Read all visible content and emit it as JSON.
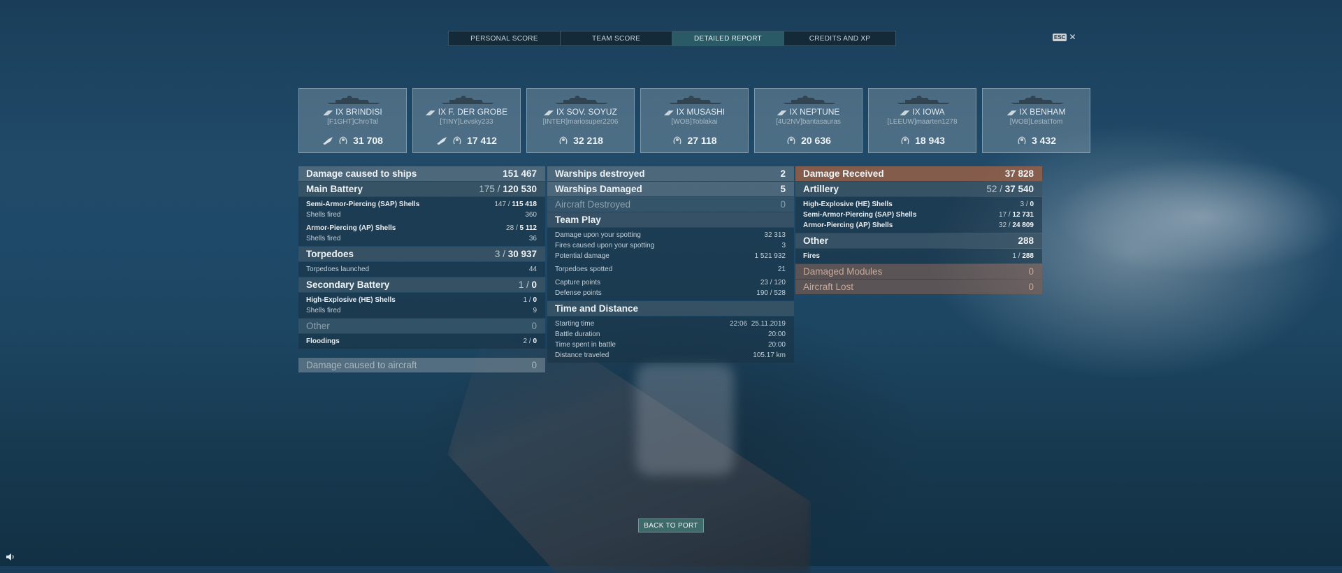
{
  "tabs": [
    {
      "label": "PERSONAL SCORE"
    },
    {
      "label": "TEAM SCORE"
    },
    {
      "label": "DETAILED REPORT"
    },
    {
      "label": "CREDITS AND XP"
    }
  ],
  "esc": {
    "key": "ESC",
    "close": "✕"
  },
  "ships": [
    {
      "tier": "IX",
      "name": "BRINDISI",
      "player": "[F1GHT]ChroTal",
      "score": "31 708",
      "has_plane": true
    },
    {
      "tier": "IX",
      "name": "F. DER GROBE",
      "player": "[TINY]Levsky233",
      "score": "17 412",
      "has_plane": true
    },
    {
      "tier": "IX",
      "name": "SOV. SOYUZ",
      "player": "[INTER]mariosuper2206",
      "score": "32 218",
      "has_plane": false
    },
    {
      "tier": "IX",
      "name": "MUSASHI",
      "player": "[WOB]Toblakai",
      "score": "27 118",
      "has_plane": false
    },
    {
      "tier": "IX",
      "name": "NEPTUNE",
      "player": "[4U2NV]bantasauras",
      "score": "20 636",
      "has_plane": false
    },
    {
      "tier": "IX",
      "name": "IOWA",
      "player": "[LEEUW]maarten1278",
      "score": "18 943",
      "has_plane": false
    },
    {
      "tier": "IX",
      "name": "BENHAM",
      "player": "[WOB]LestatTom",
      "score": "3 432",
      "has_plane": false
    }
  ],
  "damage": {
    "title": "Damage caused to ships",
    "total": "151 467",
    "main_battery": {
      "label": "Main Battery",
      "hits": "175",
      "dmg": "120 530"
    },
    "sap": {
      "label": "Semi-Armor-Piercing (SAP) Shells",
      "hits": "147",
      "dmg": "115 418"
    },
    "sap_fired": {
      "label": "Shells fired",
      "value": "360"
    },
    "ap": {
      "label": "Armor-Piercing (AP) Shells",
      "hits": "28",
      "dmg": "5 112"
    },
    "ap_fired": {
      "label": "Shells fired",
      "value": "36"
    },
    "torpedoes": {
      "label": "Torpedoes",
      "hits": "3",
      "dmg": "30 937"
    },
    "torp_launched": {
      "label": "Torpedoes launched",
      "value": "44"
    },
    "secondary": {
      "label": "Secondary Battery",
      "hits": "1",
      "dmg": "0"
    },
    "he": {
      "label": "High-Explosive (HE) Shells",
      "hits": "1",
      "dmg": "0"
    },
    "he_fired": {
      "label": "Shells fired",
      "value": "9"
    },
    "other": {
      "label": "Other",
      "value": "0"
    },
    "floodings": {
      "label": "Floodings",
      "hits": "2",
      "dmg": "0"
    },
    "aircraft": {
      "label": "Damage caused to aircraft",
      "value": "0"
    }
  },
  "warships": {
    "destroyed": {
      "label": "Warships destroyed",
      "value": "2"
    },
    "damaged": {
      "label": "Warships Damaged",
      "value": "5"
    },
    "aircraft": {
      "label": "Aircraft Destroyed",
      "value": "0"
    }
  },
  "team_play": {
    "title": "Team Play",
    "spotting_damage": {
      "label": "Damage upon your spotting",
      "value": "32 313"
    },
    "spotting_fires": {
      "label": "Fires caused upon your spotting",
      "value": "3"
    },
    "potential": {
      "label": "Potential damage",
      "value": "1 521 932"
    },
    "torps_spotted": {
      "label": "Torpedoes spotted",
      "value": "21"
    },
    "capture": {
      "label": "Capture points",
      "a": "23",
      "b": "120"
    },
    "defense": {
      "label": "Defense points",
      "a": "190",
      "b": "528"
    }
  },
  "time": {
    "title": "Time and Distance",
    "start": {
      "label": "Starting time",
      "time": "22:06",
      "date": "25.11.2019"
    },
    "duration": {
      "label": "Battle duration",
      "value": "20:00"
    },
    "spent": {
      "label": "Time spent in battle",
      "value": "20:00"
    },
    "distance": {
      "label": "Distance traveled",
      "value": "105.17 km"
    }
  },
  "received": {
    "title": "Damage Received",
    "total": "37 828",
    "artillery": {
      "label": "Artillery",
      "hits": "52",
      "dmg": "37 540"
    },
    "he": {
      "label": "High-Explosive (HE) Shells",
      "hits": "3",
      "dmg": "0"
    },
    "sap": {
      "label": "Semi-Armor-Piercing (SAP) Shells",
      "hits": "17",
      "dmg": "12 731"
    },
    "ap": {
      "label": "Armor-Piercing (AP) Shells",
      "hits": "32",
      "dmg": "24 809"
    },
    "other": {
      "label": "Other",
      "value": "288"
    },
    "fires": {
      "label": "Fires",
      "hits": "1",
      "dmg": "288"
    },
    "modules": {
      "label": "Damaged Modules",
      "value": "0"
    },
    "aircraft_lost": {
      "label": "Aircraft Lost",
      "value": "0"
    }
  },
  "back_button": "BACK TO PORT",
  "icons": {
    "ribbon": "laurel-icon",
    "plane": "aircraft-icon",
    "speaker": "speaker-icon",
    "ship": "ship-silhouette-icon"
  }
}
